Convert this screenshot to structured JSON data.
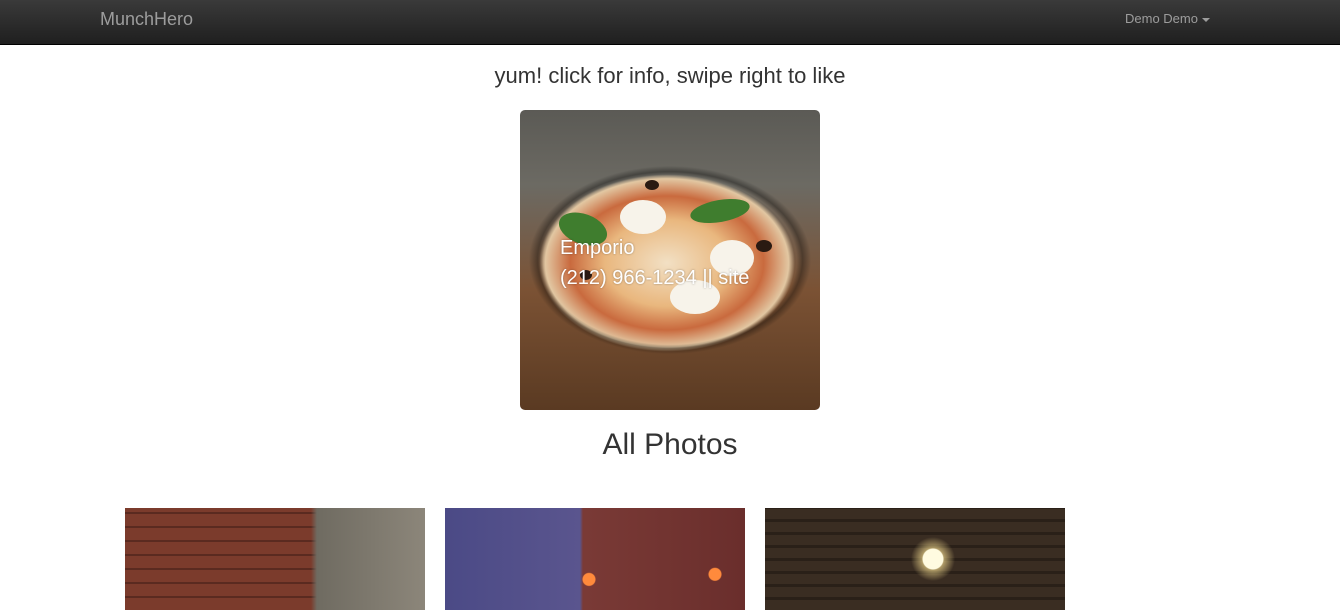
{
  "navbar": {
    "brand": "MunchHero",
    "user_menu": "Demo Demo"
  },
  "tagline": "yum! click for info, swipe right to like",
  "card": {
    "name": "Emporio",
    "phone": "(212) 966-1234",
    "separator": "||",
    "site_label": "site"
  },
  "gallery": {
    "title": "All Photos"
  }
}
